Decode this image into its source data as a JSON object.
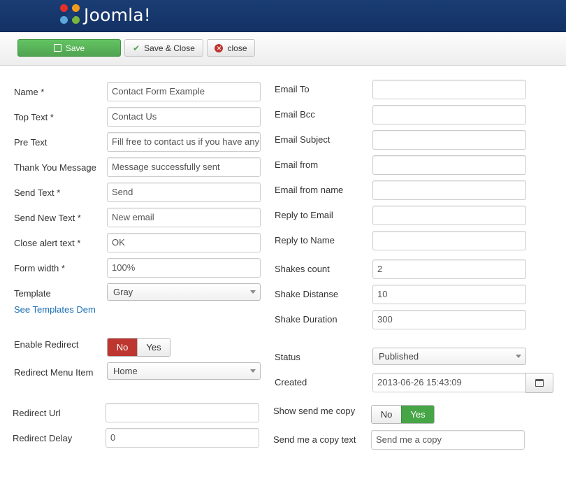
{
  "header": {
    "logo_text": "Joomla!"
  },
  "toolbar": {
    "save_label": "Save",
    "save_close_label": "Save & Close",
    "close_label": "close"
  },
  "left": {
    "name": {
      "label": "Name *",
      "value": "Contact Form Example"
    },
    "top_text": {
      "label": "Top Text *",
      "value": "Contact Us"
    },
    "pre_text": {
      "label": "Pre Text",
      "value": "Fill free to contact us if you have any"
    },
    "thank_you": {
      "label": "Thank You Message",
      "value": "Message successfully sent"
    },
    "send_text": {
      "label": "Send Text *",
      "value": "Send"
    },
    "send_new_text": {
      "label": "Send New Text *",
      "value": "New email"
    },
    "close_alert": {
      "label": "Close alert text *",
      "value": "OK"
    },
    "form_width": {
      "label": "Form width *",
      "value": "100%"
    },
    "template": {
      "label": "Template",
      "value": "Gray"
    },
    "templates_link": "See Templates Dem",
    "enable_redirect": {
      "label": "Enable Redirect",
      "no": "No",
      "yes": "Yes",
      "selected": "No"
    },
    "redirect_menu_item": {
      "label": "Redirect Menu Item",
      "value": "Home"
    },
    "redirect_url": {
      "label": "Redirect Url",
      "value": ""
    },
    "redirect_delay": {
      "label": "Redirect Delay",
      "value": "0"
    }
  },
  "right": {
    "email_to": {
      "label": "Email To",
      "value": ""
    },
    "email_bcc": {
      "label": "Email Bcc",
      "value": ""
    },
    "email_subject": {
      "label": "Email Subject",
      "value": ""
    },
    "email_from": {
      "label": "Email from",
      "value": ""
    },
    "email_from_name": {
      "label": "Email from name",
      "value": ""
    },
    "reply_to_email": {
      "label": "Reply to Email",
      "value": ""
    },
    "reply_to_name": {
      "label": "Reply to Name",
      "value": ""
    },
    "shakes_count": {
      "label": "Shakes count",
      "value": "2"
    },
    "shake_distanse": {
      "label": "Shake Distanse",
      "value": "10"
    },
    "shake_duration": {
      "label": "Shake Duration",
      "value": "300"
    },
    "status": {
      "label": "Status",
      "value": "Published"
    },
    "created": {
      "label": "Created",
      "value": "2013-06-26 15:43:09"
    },
    "show_send_copy": {
      "label": "Show send me copy",
      "no": "No",
      "yes": "Yes",
      "selected": "Yes"
    },
    "send_copy_text": {
      "label": "Send me a copy text",
      "value": "Send me a copy"
    }
  },
  "colors": {
    "header_bg": "#133265",
    "save_green": "#51a351",
    "no_red": "#bd362f",
    "yes_green": "#46a546",
    "link_blue": "#1a6fb5"
  }
}
